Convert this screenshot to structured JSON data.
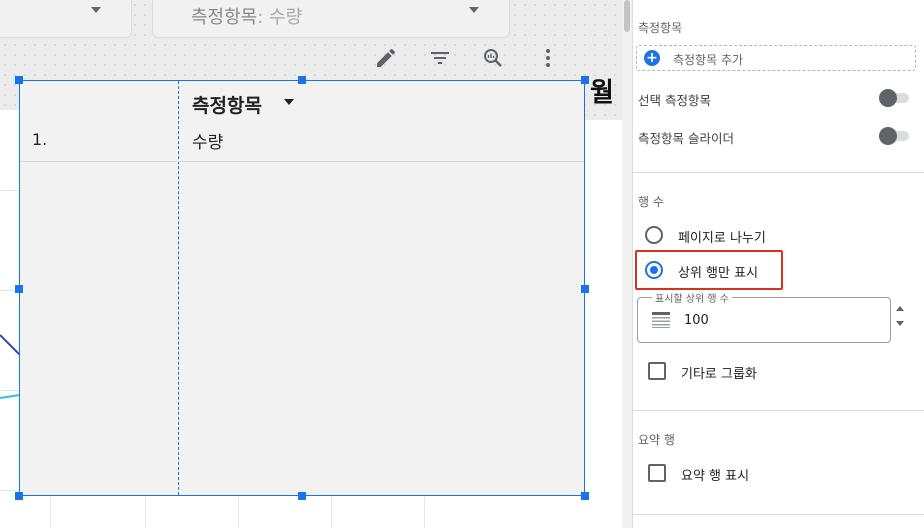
{
  "canvas": {
    "dimension_selector": {
      "label": ""
    },
    "metric_selector": {
      "prefix": "측정항목",
      "value": ": 수량"
    },
    "toolbar": {
      "icons": [
        "pencil-icon",
        "filter-icon",
        "explore-icon",
        "more-vert-icon"
      ]
    },
    "partial_header": "월",
    "table": {
      "header_metric": "측정항목",
      "rows": [
        {
          "index": "1.",
          "value": "수량"
        }
      ]
    }
  },
  "panel": {
    "metrics_section_label": "측정항목",
    "add_metric_label": "측정항목 추가",
    "optional_metrics_label": "선택 측정항목",
    "metric_slider_label": "측정항목 슬라이더",
    "rows_section_label": "행 수",
    "pagination_label": "페이지로 나누기",
    "top_rows_label": "상위 행만 표시",
    "top_rows_selected": "top_rows",
    "top_rows_field_label": "표시할 상위 행 수",
    "top_rows_field_value": "100",
    "group_others_label": "기타로 그룹화",
    "summary_section_label": "요약 행",
    "show_summary_label": "요약 행 표시"
  },
  "colors": {
    "accent": "#1a73e8",
    "highlight": "#d93025"
  }
}
